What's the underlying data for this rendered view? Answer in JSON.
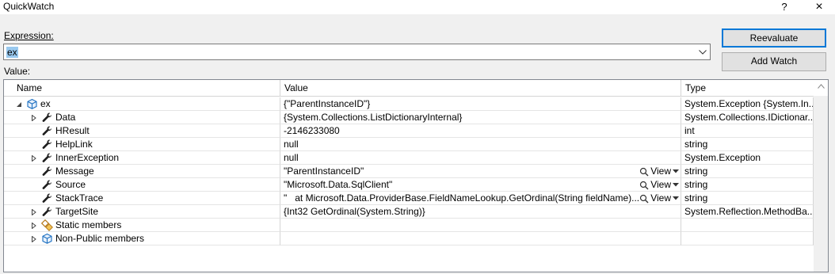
{
  "window": {
    "title": "QuickWatch",
    "help_glyph": "?",
    "close_glyph": "×"
  },
  "expression": {
    "label": "Expression:",
    "value": "ex"
  },
  "buttons": {
    "reevaluate": "Reevaluate",
    "add_watch": "Add Watch"
  },
  "value_label": "Value:",
  "columns": {
    "name": "Name",
    "value": "Value",
    "type": "Type"
  },
  "rows": [
    {
      "name": "ex",
      "value": "{\"ParentInstanceID\"}",
      "type": "System.Exception {System.In...",
      "level": 0,
      "expander": "expanded",
      "icon": "object-icon"
    },
    {
      "name": "Data",
      "value": "{System.Collections.ListDictionaryInternal}",
      "type": "System.Collections.IDictionar...",
      "level": 1,
      "expander": "collapsed",
      "icon": "wrench-icon"
    },
    {
      "name": "HResult",
      "value": "-2146233080",
      "type": "int",
      "level": 1,
      "expander": "none",
      "icon": "wrench-icon"
    },
    {
      "name": "HelpLink",
      "value": "null",
      "type": "string",
      "level": 1,
      "expander": "none",
      "icon": "wrench-icon"
    },
    {
      "name": "InnerException",
      "value": "null",
      "type": "System.Exception",
      "level": 1,
      "expander": "collapsed",
      "icon": "wrench-icon"
    },
    {
      "name": "Message",
      "value": "\"ParentInstanceID\"",
      "type": "string",
      "level": 1,
      "expander": "none",
      "icon": "wrench-icon",
      "view": "View"
    },
    {
      "name": "Source",
      "value": "\"Microsoft.Data.SqlClient\"",
      "type": "string",
      "level": 1,
      "expander": "none",
      "icon": "wrench-icon",
      "view": "View"
    },
    {
      "name": "StackTrace",
      "value": "\"   at Microsoft.Data.ProviderBase.FieldNameLookup.GetOrdinal(String fieldName)...",
      "type": "string",
      "level": 1,
      "expander": "none",
      "icon": "wrench-icon",
      "view": "View"
    },
    {
      "name": "TargetSite",
      "value": "{Int32 GetOrdinal(System.String)}",
      "type": "System.Reflection.MethodBa...",
      "level": 1,
      "expander": "collapsed",
      "icon": "wrench-icon"
    },
    {
      "name": "Static members",
      "value": "",
      "type": "",
      "level": 1,
      "expander": "collapsed",
      "icon": "static-members-icon"
    },
    {
      "name": "Non-Public members",
      "value": "",
      "type": "",
      "level": 1,
      "expander": "collapsed",
      "icon": "object-icon"
    }
  ],
  "colors": {
    "selection": "#99c9ef",
    "default_button_border": "#0078d7",
    "grid_line": "#d5d5d5",
    "object_icon": "#1c6fc1"
  }
}
